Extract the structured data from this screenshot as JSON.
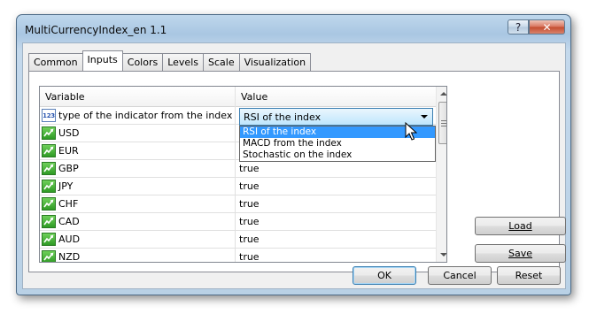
{
  "window": {
    "title": "MultiCurrencyIndex_en 1.1",
    "help_label": "?",
    "close_label": "x"
  },
  "tabs": [
    {
      "label": "Common"
    },
    {
      "label": "Inputs"
    },
    {
      "label": "Colors"
    },
    {
      "label": "Levels"
    },
    {
      "label": "Scale"
    },
    {
      "label": "Visualization"
    }
  ],
  "active_tab": "Inputs",
  "grid": {
    "columns": {
      "variable": "Variable",
      "value": "Value"
    },
    "rows": [
      {
        "icon": "number-icon",
        "icon_text": "123",
        "variable": "type of the indicator from the index",
        "value": "RSI of the index"
      },
      {
        "icon": "boolean-icon",
        "variable": "USD",
        "value": "true"
      },
      {
        "icon": "boolean-icon",
        "variable": "EUR",
        "value": "true"
      },
      {
        "icon": "boolean-icon",
        "variable": "GBP",
        "value": "true"
      },
      {
        "icon": "boolean-icon",
        "variable": "JPY",
        "value": "true"
      },
      {
        "icon": "boolean-icon",
        "variable": "CHF",
        "value": "true"
      },
      {
        "icon": "boolean-icon",
        "variable": "CAD",
        "value": "true"
      },
      {
        "icon": "boolean-icon",
        "variable": "AUD",
        "value": "true"
      },
      {
        "icon": "boolean-icon",
        "variable": "NZD",
        "value": "true"
      }
    ],
    "combo": {
      "selected": "RSI of the index",
      "options": [
        "RSI of the index",
        "MACD from the index",
        "Stochastic on the index"
      ]
    }
  },
  "side_buttons": {
    "load": "Load",
    "save": "Save"
  },
  "footer_buttons": {
    "ok": "OK",
    "cancel": "Cancel",
    "reset": "Reset"
  },
  "colors": {
    "selection": "#3399ff",
    "combo_border": "#3c7fb1",
    "close_button": "#c44b2e"
  }
}
